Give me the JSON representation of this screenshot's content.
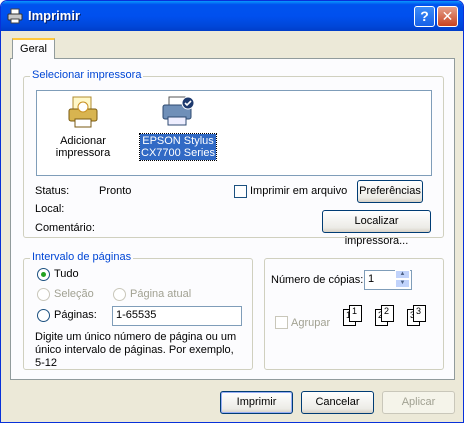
{
  "window": {
    "title": "Imprimir"
  },
  "tabs": [
    {
      "label": "Geral"
    }
  ],
  "printer_section": {
    "label": "Selecionar impressora",
    "items": [
      {
        "label_line1": "Adicionar",
        "label_line2": "impressora",
        "icon": "add-printer-icon"
      },
      {
        "label_line1": "EPSON Stylus",
        "label_line2": "CX7700 Series",
        "icon": "printer-icon",
        "selected": true
      }
    ],
    "status_label": "Status:",
    "status_value": "Pronto",
    "location_label": "Local:",
    "comment_label": "Comentário:",
    "print_to_file_label": "Imprimir em arquivo",
    "preferences_button": "Preferências",
    "find_printer_button": "Localizar impressora..."
  },
  "page_range": {
    "label": "Intervalo de páginas",
    "all": "Tudo",
    "selection": "Seleção",
    "current_page": "Página atual",
    "pages": "Páginas:",
    "pages_value": "1-65535",
    "hint_line1": "Digite um único número de página ou um",
    "hint_line2": "único intervalo de páginas. Por exemplo,",
    "hint_line3": "5-12"
  },
  "copies": {
    "label": "Número de cópias:",
    "value": "1",
    "collate": "Agrupar"
  },
  "buttons": {
    "print": "Imprimir",
    "cancel": "Cancelar",
    "apply": "Aplicar"
  },
  "colors": {
    "accent": "#0046d5",
    "title_bar": "#0053ee",
    "selection": "#316ac5"
  }
}
